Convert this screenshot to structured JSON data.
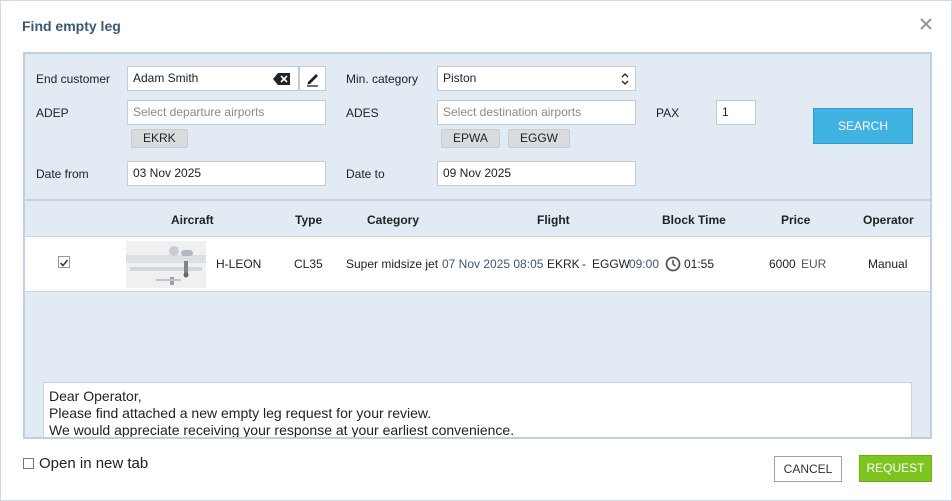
{
  "dialog": {
    "title": "Find empty leg",
    "close_icon": "close-icon"
  },
  "filters": {
    "end_customer": {
      "label": "End customer",
      "value": "Adam Smith"
    },
    "min_category": {
      "label": "Min. category",
      "value": "Piston"
    },
    "adep": {
      "label": "ADEP",
      "placeholder": "Select departure airports",
      "chips": [
        "EKRK"
      ]
    },
    "ades": {
      "label": "ADES",
      "placeholder": "Select destination airports",
      "chips": [
        "EPWA",
        "EGGW"
      ]
    },
    "pax": {
      "label": "PAX",
      "value": "1"
    },
    "date_from": {
      "label": "Date from",
      "value": "03 Nov 2025"
    },
    "date_to": {
      "label": "Date to",
      "value": "09 Nov 2025"
    },
    "search_label": "SEARCH"
  },
  "table": {
    "headers": [
      "Aircraft",
      "Type",
      "Category",
      "Flight",
      "Block Time",
      "Price",
      "Operator"
    ],
    "rows": [
      {
        "checked": true,
        "registration": "H-LEON",
        "type": "CL35",
        "category": "Super midsize jet",
        "departure_datetime": "07 Nov 2025 08:05",
        "from": "EKRK",
        "separator": "-",
        "to": "EGGW",
        "arrival_time": "09:00",
        "block_time": "01:55",
        "price": "6000",
        "currency": "EUR",
        "operator": "Manual"
      }
    ]
  },
  "message": {
    "lines": [
      "Dear Operator,",
      "Please find attached a new empty leg request for your review.",
      "We would appreciate receiving your response at your earliest convenience."
    ]
  },
  "footer": {
    "open_new_tab_label": "Open in new tab",
    "cancel_label": "CANCEL",
    "request_label": "REQUEST"
  },
  "colors": {
    "title": "#3b5875",
    "panel_bg": "#e2eaf3",
    "search_button": "#41b3e3",
    "request_button": "#7dc41f"
  }
}
